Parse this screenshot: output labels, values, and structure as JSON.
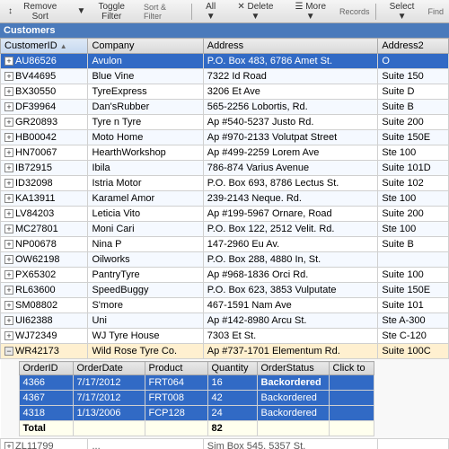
{
  "toolbar": {
    "buttons": [
      {
        "label": "Remove Sort",
        "icon": "×"
      },
      {
        "label": "Toggle Filter",
        "icon": "▼"
      },
      {
        "label": "All ▼",
        "icon": ""
      },
      {
        "label": "✕ Delete ▼",
        "icon": ""
      },
      {
        "label": "☰ More ▼",
        "icon": ""
      },
      {
        "label": "Select ▼",
        "icon": ""
      }
    ],
    "sections": [
      {
        "label": "Sort & Filter"
      },
      {
        "label": "Records"
      },
      {
        "label": "Find"
      }
    ]
  },
  "table": {
    "title": "Customers",
    "columns": [
      {
        "label": "CustomerID",
        "sorted": true
      },
      {
        "label": "Company"
      },
      {
        "label": "Address"
      },
      {
        "label": "Address2"
      }
    ],
    "rows": [
      {
        "id": "AU86526",
        "company": "Avulon",
        "address": "P.O. Box 483, 6786 Amet St.",
        "address2": "O",
        "selected": true
      },
      {
        "id": "BV44695",
        "company": "Blue Vine",
        "address": "7322 Id Road",
        "address2": "Suite 150",
        "selected": false
      },
      {
        "id": "BX30550",
        "company": "TyreExpress",
        "address": "3206 Et Ave",
        "address2": "Suite D",
        "selected": false
      },
      {
        "id": "DF39964",
        "company": "Dan'sRubber",
        "address": "565-2256 Lobortis, Rd.",
        "address2": "Suite B",
        "selected": false
      },
      {
        "id": "GR20893",
        "company": "Tyre n Tyre",
        "address": "Ap #540-5237 Justo Rd.",
        "address2": "Suite 200",
        "selected": false
      },
      {
        "id": "HB00042",
        "company": "Moto Home",
        "address": "Ap #970-2133 Volutpat Street",
        "address2": "Suite 150E",
        "selected": false
      },
      {
        "id": "HN70067",
        "company": "HearthWorkshop",
        "address": "Ap #499-2259 Lorem Ave",
        "address2": "Ste 100",
        "selected": false
      },
      {
        "id": "IB72915",
        "company": "Ibila",
        "address": "786-874 Varius Avenue",
        "address2": "Suite 101D",
        "selected": false
      },
      {
        "id": "ID32098",
        "company": "Istria Motor",
        "address": "P.O. Box 693, 8786 Lectus St.",
        "address2": "Suite 102",
        "selected": false
      },
      {
        "id": "KA13911",
        "company": "Karamel Amor",
        "address": "239-2143 Neque. Rd.",
        "address2": "Ste 100",
        "selected": false
      },
      {
        "id": "LV84203",
        "company": "Leticia Vito",
        "address": "Ap #199-5967 Ornare, Road",
        "address2": "Suite 200",
        "selected": false
      },
      {
        "id": "MC27801",
        "company": "Moni Cari",
        "address": "P.O. Box 122, 2512 Velit. Rd.",
        "address2": "Ste 100",
        "selected": false
      },
      {
        "id": "NP00678",
        "company": "Nina P",
        "address": "147-2960 Eu Av.",
        "address2": "Suite B",
        "selected": false
      },
      {
        "id": "OW62198",
        "company": "Oilworks",
        "address": "P.O. Box 288, 4880 In, St.",
        "address2": "",
        "selected": false
      },
      {
        "id": "PX65302",
        "company": "PantryTyre",
        "address": "Ap #968-1836 Orci Rd.",
        "address2": "Suite 100",
        "selected": false
      },
      {
        "id": "RL63600",
        "company": "SpeedBuggy",
        "address": "P.O. Box 623, 3853 Vulputate",
        "address2": "Suite 150E",
        "selected": false
      },
      {
        "id": "SM08802",
        "company": "S'more",
        "address": "467-1591 Nam Ave",
        "address2": "Suite 101",
        "selected": false
      },
      {
        "id": "UI62388",
        "company": "Uni",
        "address": "Ap #142-8980 Arcu St.",
        "address2": "Ste A-300",
        "selected": false
      },
      {
        "id": "WJ72349",
        "company": "WJ Tyre House",
        "address": "7303 Et St.",
        "address2": "Ste C-120",
        "selected": false
      },
      {
        "id": "WR42173",
        "company": "Wild Rose Tyre Co.",
        "address": "Ap #737-1701 Elementum Rd.",
        "address2": "Suite 100C",
        "selected": false,
        "expanded": true
      }
    ]
  },
  "subtable": {
    "parentId": "WR42173",
    "columns": [
      "OrderID",
      "OrderDate",
      "Product",
      "Quantity",
      "OrderStatus",
      "Click to"
    ],
    "rows": [
      {
        "orderId": "4366",
        "orderDate": "7/17/2012",
        "product": "FRT064",
        "quantity": "16",
        "status": "Backordered",
        "selected": true
      },
      {
        "orderId": "4367",
        "orderDate": "7/17/2012",
        "product": "FRT008",
        "quantity": "42",
        "status": "Backordered",
        "selected": true
      },
      {
        "orderId": "4318",
        "orderDate": "1/13/2006",
        "product": "FCP128",
        "quantity": "24",
        "status": "Backordered",
        "selected": true
      }
    ],
    "totalRow": {
      "label": "Total",
      "quantity": "82"
    },
    "partialText": "Ste C-120"
  },
  "extraRow": {
    "id": "ZL11799",
    "company": "...",
    "address": "Sim Box 545, 5357 St.",
    "address2": ""
  }
}
